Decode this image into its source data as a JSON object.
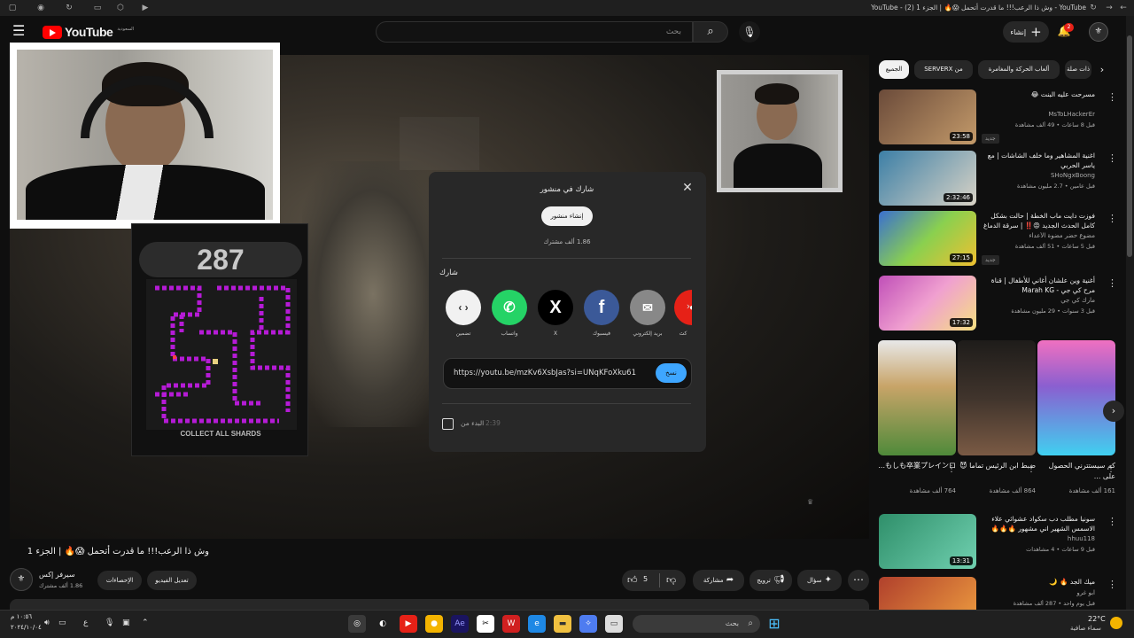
{
  "browser": {
    "window_title": "YouTube - وش ذا الرعب!!! ما قدرت أتحمل 😱🔥 | الجزء 1 (2) - YouTube"
  },
  "header": {
    "logo_text": "YouTube",
    "logo_region": "السعودية",
    "search_placeholder": "بحث",
    "create_label": "إنشاء",
    "notifications_count": "2"
  },
  "game": {
    "score": "287",
    "caption": "COLLECT ALL SHARDS"
  },
  "share_dialog": {
    "title": "شارك في منشور",
    "create_post_label": "إنشاء منشور",
    "subscribers": "1.86 ألف مشترك",
    "share_label": "شارك",
    "targets": [
      {
        "label": "تضمين",
        "icon": "embed-icon",
        "color": "#f1f1f1"
      },
      {
        "label": "واتساب",
        "icon": "whatsapp-icon",
        "color": "#25d366"
      },
      {
        "label": "X",
        "icon": "x-icon",
        "color": "#000000"
      },
      {
        "label": "فيسبوك",
        "icon": "facebook-icon",
        "color": "#3b5998"
      },
      {
        "label": "بريد إلكتروني",
        "icon": "email-icon",
        "color": "#888888"
      },
      {
        "label": "كث",
        "icon": "kakao-icon",
        "color": "#e62117"
      }
    ],
    "url": "https://youtu.be/mzKv6XsbJas?si=UNqKFoXku61",
    "copy_label": "نسخ",
    "start_at_label": "البدء من",
    "start_time": "2:39"
  },
  "video": {
    "title": "وش ذا الرعب!!! ما قدرت أتحمل 😱🔥 | الجزء 1",
    "channel_name": "سيرفر إكس",
    "channel_subs": "1.86 ألف مشترك",
    "analytics_label": "الإحصاءات",
    "edit_label": "تعديل الفيديو",
    "like_count": "5",
    "share_label": "مشاركة",
    "promote_label": "ترويج",
    "ask_label": "سؤال"
  },
  "sidebar": {
    "chips": [
      "الجميع",
      "من SERVERX",
      "ألعاب الحركة والمغامرة",
      "ذات صلة"
    ],
    "recommendations": [
      {
        "title": "مسرحت عليه البنت 😂",
        "channel": "MsToLHackerEr",
        "meta": "قبل 8 ساعات • 49 ألف مشاهدة",
        "duration": "23:58",
        "new": "جديد",
        "thumb": "#6b4b3a"
      },
      {
        "title": "اغنية المشاهير وما خلف الشاشات | مع ياسر الحربي",
        "channel": "SHoNgxBoong",
        "meta": "قبل عامين • 2.7 مليون مشاهدة",
        "duration": "2:32:46",
        "new": "",
        "thumb": "#3c7fa6"
      },
      {
        "title": "فوزت دايت ماب الخطة | حالت بشكل كامل الحدث الجديد 😡‼️ | سرقة الدماغ في ...",
        "channel": "مضوع حضر مضوة الأعداء",
        "meta": "قبل 5 ساعات • 51 ألف مشاهدة",
        "duration": "27:15",
        "new": "جديد",
        "thumb": "#4f8a3a"
      },
      {
        "title": "أغنية وين علشان أغاني للأطفال | قناة مرح كي جي - Marah KG",
        "channel": "مارك كي جي",
        "meta": "قبل 3 سنوات • 29 مليون مشاهدة",
        "duration": "17:32",
        "new": "",
        "thumb": "#c04fb8"
      },
      {
        "title": "سونيا مطلب دب سكواد عشوائي علاء الاسمس الشهير اني مشهور 🔥🔥🔥",
        "channel": "hhuu118",
        "meta": "قبل 9 ساعات • 4 مشاهدات",
        "duration": "13:31",
        "new": "",
        "thumb": "#2f8f6a"
      },
      {
        "title": "ميك الجد 🔥 🌙",
        "channel": "ابو غرو",
        "meta": "قبل يوم واحد • 287 ألف مشاهدة",
        "duration": "",
        "new": "",
        "thumb": "#b0402c"
      }
    ],
    "shorts": [
      {
        "title": "もしも卒業プレインロ...",
        "views": "764 ألف مشاهدة",
        "thumb": "#c8a468"
      },
      {
        "title": "ضبط ابن الرئيس تماما 😈",
        "views": "864 ألف مشاهدة",
        "thumb": "#40342c"
      },
      {
        "title": "كم سيستترني الحصول على ...",
        "views": "161 ألف مشاهدة",
        "thumb": "#8a5fd0"
      }
    ]
  },
  "taskbar": {
    "search_label": "بحث",
    "time": "١٠:٥٦ م",
    "date": "٢٠٢٤/١٠/٠٤",
    "temperature": "22°C",
    "weather": "سماء صافية",
    "lang": "ع"
  }
}
